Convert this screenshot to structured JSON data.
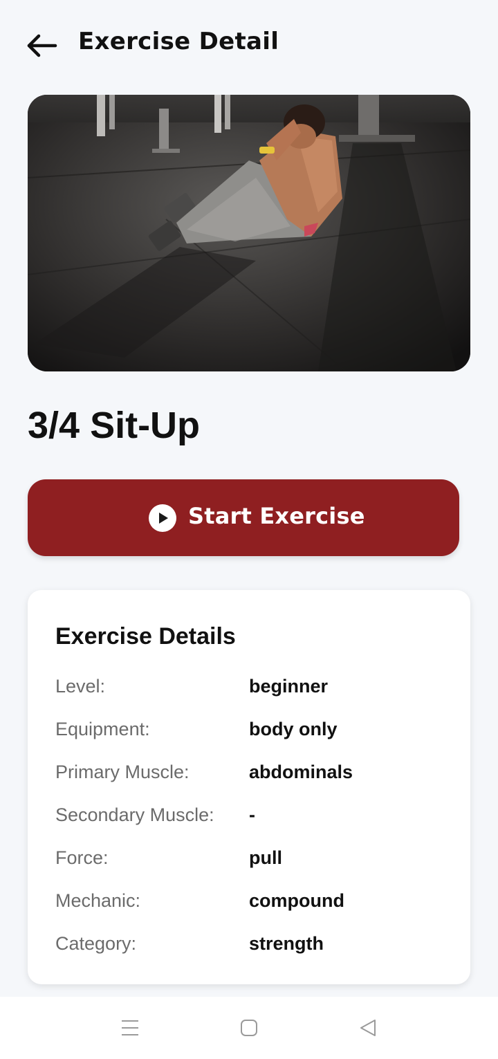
{
  "header": {
    "title": "Exercise Detail",
    "back_icon": "arrow-left-icon"
  },
  "exercise": {
    "name": "3/4 Sit-Up",
    "image_description_icon": "exercise-photo"
  },
  "start_button": {
    "label": "Start Exercise",
    "icon": "play-circle-icon",
    "color": "#8f1f21"
  },
  "details": {
    "title": "Exercise Details",
    "rows": [
      {
        "label": "Level:",
        "value": "beginner"
      },
      {
        "label": "Equipment:",
        "value": "body only"
      },
      {
        "label": "Primary Muscle:",
        "value": "abdominals"
      },
      {
        "label": "Secondary Muscle:",
        "value": "-"
      },
      {
        "label": "Force:",
        "value": "pull"
      },
      {
        "label": "Mechanic:",
        "value": "compound"
      },
      {
        "label": "Category:",
        "value": "strength"
      }
    ]
  },
  "nav": {
    "items": [
      "menu-icon",
      "home-square-icon",
      "back-triangle-icon"
    ]
  }
}
